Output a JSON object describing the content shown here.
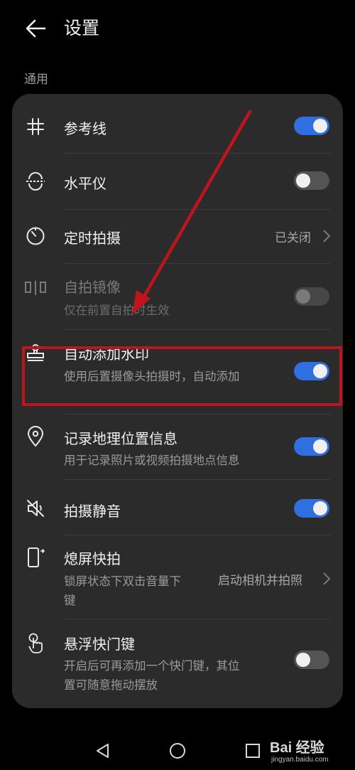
{
  "header": {
    "title": "设置",
    "back_icon": "arrow-left-icon"
  },
  "section": {
    "title": "通用"
  },
  "settings": [
    {
      "id": "grid",
      "icon": "grid-hash-icon",
      "title": "参考线",
      "toggle": "on"
    },
    {
      "id": "level",
      "icon": "level-icon",
      "title": "水平仪",
      "toggle": "off"
    },
    {
      "id": "timer",
      "icon": "timer-icon",
      "title": "定时拍摄",
      "value": "已关闭"
    },
    {
      "id": "mirror",
      "icon": "mirror-icon",
      "title": "自拍镜像",
      "subtitle": "仅在前置自拍时生效",
      "toggle": "off",
      "disabled": true
    },
    {
      "id": "watermark",
      "icon": "stamp-icon",
      "title": "自动添加水印",
      "subtitle": "使用后置摄像头拍摄时，自动添加",
      "toggle": "on"
    },
    {
      "id": "location",
      "icon": "location-pin-icon",
      "title": "记录地理位置信息",
      "subtitle": "用于记录照片或视频拍摄地点信息",
      "toggle": "on"
    },
    {
      "id": "mute",
      "icon": "speaker-mute-icon",
      "title": "拍摄静音",
      "toggle": "on"
    },
    {
      "id": "snapshot",
      "icon": "phone-snapshot-icon",
      "title": "熄屏快拍",
      "subtitle_line1": "锁屏状态下双击音量下",
      "subtitle_line2": "键",
      "value": "启动相机并拍照"
    },
    {
      "id": "floating",
      "icon": "touch-hand-icon",
      "title": "悬浮快门键",
      "subtitle_line1": "开启后可再添加一个快门键，其位",
      "subtitle_line2": "置可随意拖动摆放",
      "toggle": "off"
    }
  ],
  "navbar": {
    "back_icon": "nav-back-triangle-icon",
    "home_icon": "nav-home-circle-icon",
    "recent_icon": "nav-recent-square-icon"
  },
  "watermark_overlay": {
    "brand": "Bai 经验",
    "url": "jingyan.baidu.com"
  },
  "colors": {
    "background": "#000000",
    "card": "#2b2b2b",
    "toggle_on": "#2f6fe0",
    "toggle_off": "#545454",
    "annotation": "#c0141c"
  }
}
